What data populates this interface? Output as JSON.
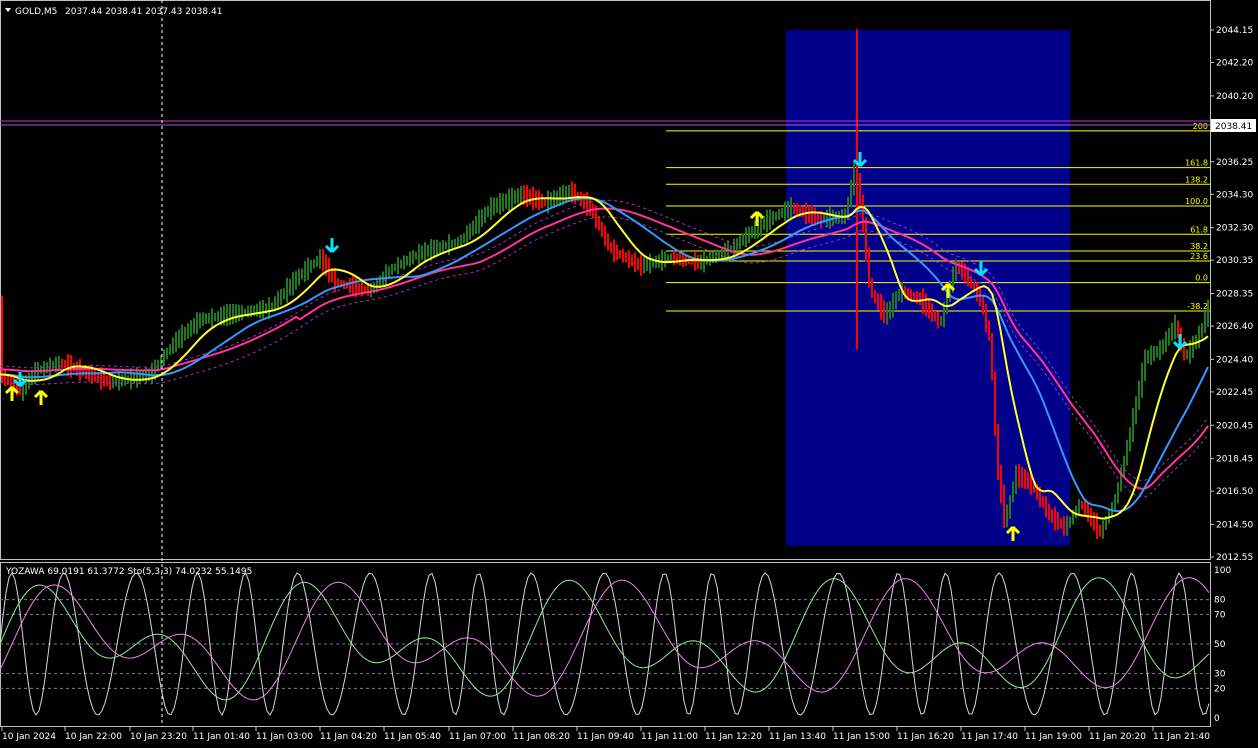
{
  "header": {
    "symbol": "GOLD,M5",
    "ohlc": "2037.44 2038.41 2037.43 2038.41"
  },
  "price_axis": {
    "labels": [
      "2044.15",
      "2042.20",
      "2040.20",
      "2038.41",
      "2036.25",
      "2034.30",
      "2032.30",
      "2030.35",
      "2028.35",
      "2026.40",
      "2024.40",
      "2022.45",
      "2020.45",
      "2018.45",
      "2016.50",
      "2014.50",
      "2012.55"
    ],
    "current_price": "2038.41"
  },
  "fib_levels": [
    {
      "label": "200",
      "price": 2038.1,
      "color": "#ffff00"
    },
    {
      "label": "161.8",
      "price": 2035.9,
      "color": "#ffff00"
    },
    {
      "label": "138.2",
      "price": 2034.9,
      "color": "#ffff00"
    },
    {
      "label": "100.0",
      "price": 2033.6,
      "color": "#ffff00"
    },
    {
      "label": "61.8",
      "price": 2031.9,
      "color": "#ffff00"
    },
    {
      "label": "38.2",
      "price": 2030.9,
      "color": "#ffff00"
    },
    {
      "label": "23.6",
      "price": 2030.3,
      "color": "#ffff00"
    },
    {
      "label": "0.0",
      "price": 2029.0,
      "color": "#ffff00"
    },
    {
      "label": "-38.2",
      "price": 2027.3,
      "color": "#ffff00"
    }
  ],
  "indicator": {
    "label": "YOZAWA 69.0191 61.3772  Sto(5,3,3) 74.0232 55.1495",
    "levels": [
      "100",
      "80",
      "70",
      "50",
      "30",
      "20",
      "0"
    ]
  },
  "time_axis": [
    "10 Jan 2024",
    "10 Jan 22:00",
    "10 Jan 23:20",
    "11 Jan 01:40",
    "11 Jan 03:00",
    "11 Jan 04:20",
    "11 Jan 05:40",
    "11 Jan 07:00",
    "11 Jan 08:20",
    "11 Jan 09:40",
    "11 Jan 11:00",
    "11 Jan 12:20",
    "11 Jan 13:40",
    "11 Jan 15:00",
    "11 Jan 16:20",
    "11 Jan 17:40",
    "11 Jan 19:00",
    "11 Jan 20:20",
    "11 Jan 21:40"
  ],
  "colors": {
    "bull": "#1f7a1f",
    "bear": "#ff0000",
    "ma_yellow": "#ffff33",
    "ma_blue": "#3399ff",
    "ma_pink": "#ff3399",
    "rect": "#00008b",
    "signal_down": "#00e5ff",
    "signal_up": "#ffff00",
    "magenta_line": "#cc33cc"
  },
  "icons": {
    "menu": "triangle-down-icon",
    "up_signal": "up-arrow-icon",
    "down_signal": "down-arrow-icon"
  }
}
